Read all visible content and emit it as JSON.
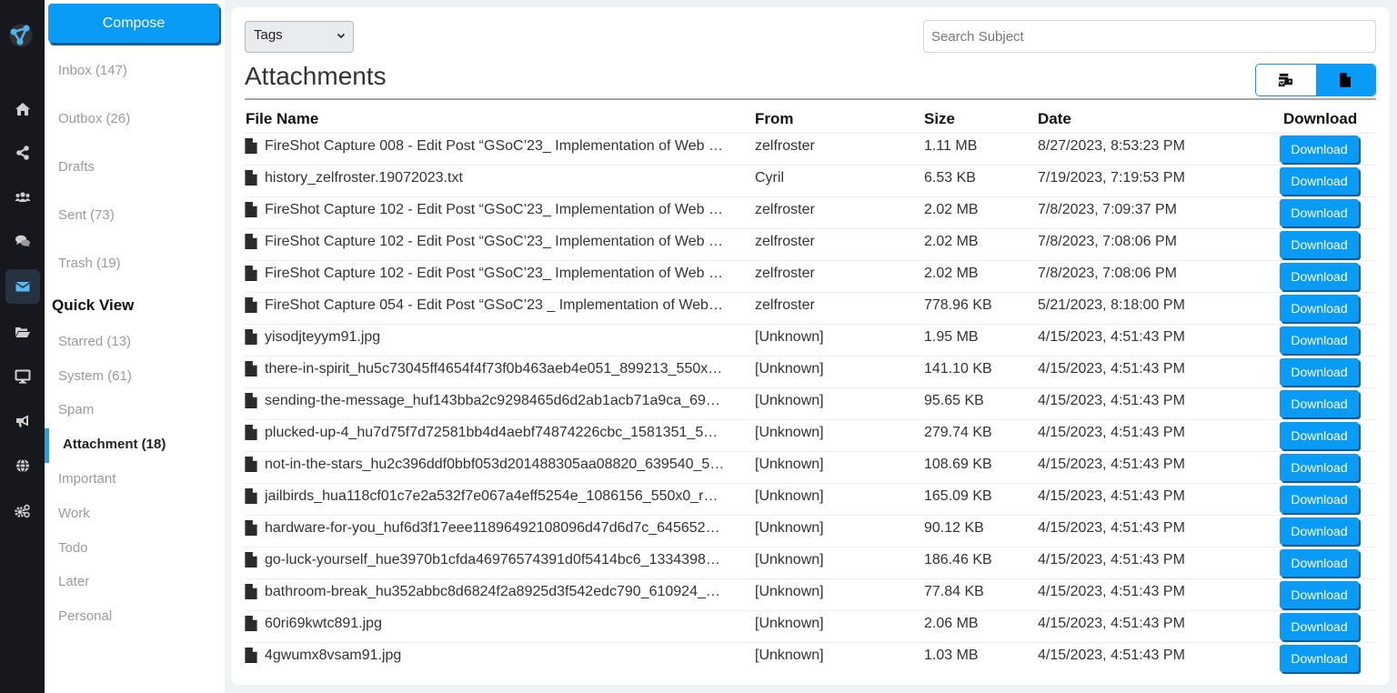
{
  "rail": {
    "items": [
      {
        "icon": "home-icon"
      },
      {
        "icon": "share-icon"
      },
      {
        "icon": "users-icon"
      },
      {
        "icon": "chat-icon"
      },
      {
        "icon": "envelope-icon",
        "active": true
      },
      {
        "icon": "folder-open-icon"
      },
      {
        "icon": "desktop-icon"
      },
      {
        "icon": "megaphone-icon"
      },
      {
        "icon": "globe-icon"
      },
      {
        "icon": "cogs-icon"
      }
    ],
    "accent": "#4fb3e8"
  },
  "sidebar": {
    "compose_label": "Compose",
    "folders": [
      {
        "label": "Inbox (147)"
      },
      {
        "label": "Outbox (26)"
      },
      {
        "label": "Drafts"
      },
      {
        "label": "Sent (73)"
      },
      {
        "label": "Trash (19)"
      }
    ],
    "quick_view_title": "Quick View",
    "quick_view": [
      {
        "label": "Starred (13)"
      },
      {
        "label": "System (61)"
      },
      {
        "label": "Spam"
      },
      {
        "label": "Attachment (18)",
        "active": true
      },
      {
        "label": "Important"
      },
      {
        "label": "Work"
      },
      {
        "label": "Todo"
      },
      {
        "label": "Later"
      },
      {
        "label": "Personal"
      }
    ]
  },
  "main": {
    "tags_select": {
      "selected": "Tags"
    },
    "search": {
      "placeholder": "Search Subject",
      "value": ""
    },
    "title": "Attachments",
    "view_toggle": [
      {
        "icon": "mail-bulk-icon",
        "active": false
      },
      {
        "icon": "file-icon",
        "active": true
      }
    ],
    "columns": {
      "file_name": "File Name",
      "from": "From",
      "size": "Size",
      "date": "Date",
      "download": "Download"
    },
    "download_label": "Download",
    "rows": [
      {
        "file_name": "FireShot Capture 008 - Edit Post “GSoC’23_ Implementation of Web …",
        "from": "zelfroster",
        "size": "1.11 MB",
        "date": "8/27/2023, 8:53:23 PM"
      },
      {
        "file_name": "history_zelfroster.19072023.txt",
        "from": "Cyril",
        "size": "6.53 KB",
        "date": "7/19/2023, 7:19:53 PM"
      },
      {
        "file_name": "FireShot Capture 102 - Edit Post “GSoC’23_ Implementation of Web …",
        "from": "zelfroster",
        "size": "2.02 MB",
        "date": "7/8/2023, 7:09:37 PM"
      },
      {
        "file_name": "FireShot Capture 102 - Edit Post “GSoC’23_ Implementation of Web …",
        "from": "zelfroster",
        "size": "2.02 MB",
        "date": "7/8/2023, 7:08:06 PM"
      },
      {
        "file_name": "FireShot Capture 102 - Edit Post “GSoC’23_ Implementation of Web …",
        "from": "zelfroster",
        "size": "2.02 MB",
        "date": "7/8/2023, 7:08:06 PM"
      },
      {
        "file_name": "FireShot Capture 054 - Edit Post “GSoC’23 _ Implementation of Web…",
        "from": "zelfroster",
        "size": "778.96 KB",
        "date": "5/21/2023, 8:18:00 PM"
      },
      {
        "file_name": "yisodjteyym91.jpg",
        "from": "[Unknown]",
        "size": "1.95 MB",
        "date": "4/15/2023, 4:51:43 PM"
      },
      {
        "file_name": "there-in-spirit_hu5c73045ff4654f4f73f0b463aeb4e051_899213_550x…",
        "from": "[Unknown]",
        "size": "141.10 KB",
        "date": "4/15/2023, 4:51:43 PM"
      },
      {
        "file_name": "sending-the-message_huf143bba2c9298465d6d2ab1acb71a9ca_69…",
        "from": "[Unknown]",
        "size": "95.65 KB",
        "date": "4/15/2023, 4:51:43 PM"
      },
      {
        "file_name": "plucked-up-4_hu7d75f7d72581bb4d4aebf74874226cbc_1581351_5…",
        "from": "[Unknown]",
        "size": "279.74 KB",
        "date": "4/15/2023, 4:51:43 PM"
      },
      {
        "file_name": "not-in-the-stars_hu2c396ddf0bbf053d201488305aa08820_639540_5…",
        "from": "[Unknown]",
        "size": "108.69 KB",
        "date": "4/15/2023, 4:51:43 PM"
      },
      {
        "file_name": "jailbirds_hua118cf01c7e2a532f7e067a4eff5254e_1086156_550x0_r…",
        "from": "[Unknown]",
        "size": "165.09 KB",
        "date": "4/15/2023, 4:51:43 PM"
      },
      {
        "file_name": "hardware-for-you_huf6d3f17eee11896492108096d47d6d7c_645652…",
        "from": "[Unknown]",
        "size": "90.12 KB",
        "date": "4/15/2023, 4:51:43 PM"
      },
      {
        "file_name": "go-luck-yourself_hue3970b1cfda46976574391d0f5414bc6_1334398…",
        "from": "[Unknown]",
        "size": "186.46 KB",
        "date": "4/15/2023, 4:51:43 PM"
      },
      {
        "file_name": "bathroom-break_hu352abbc8d6824f2a8925d3f542edc790_610924_…",
        "from": "[Unknown]",
        "size": "77.84 KB",
        "date": "4/15/2023, 4:51:43 PM"
      },
      {
        "file_name": "60ri69kwtc891.jpg",
        "from": "[Unknown]",
        "size": "2.06 MB",
        "date": "4/15/2023, 4:51:43 PM"
      },
      {
        "file_name": "4gwumx8vsam91.jpg",
        "from": "[Unknown]",
        "size": "1.03 MB",
        "date": "4/15/2023, 4:51:43 PM"
      }
    ]
  },
  "colors": {
    "primary": "#0a9bf6",
    "primary_shadow": "#0a5d96",
    "rail_bg": "#16181d",
    "muted_text": "#9b9b9b"
  }
}
